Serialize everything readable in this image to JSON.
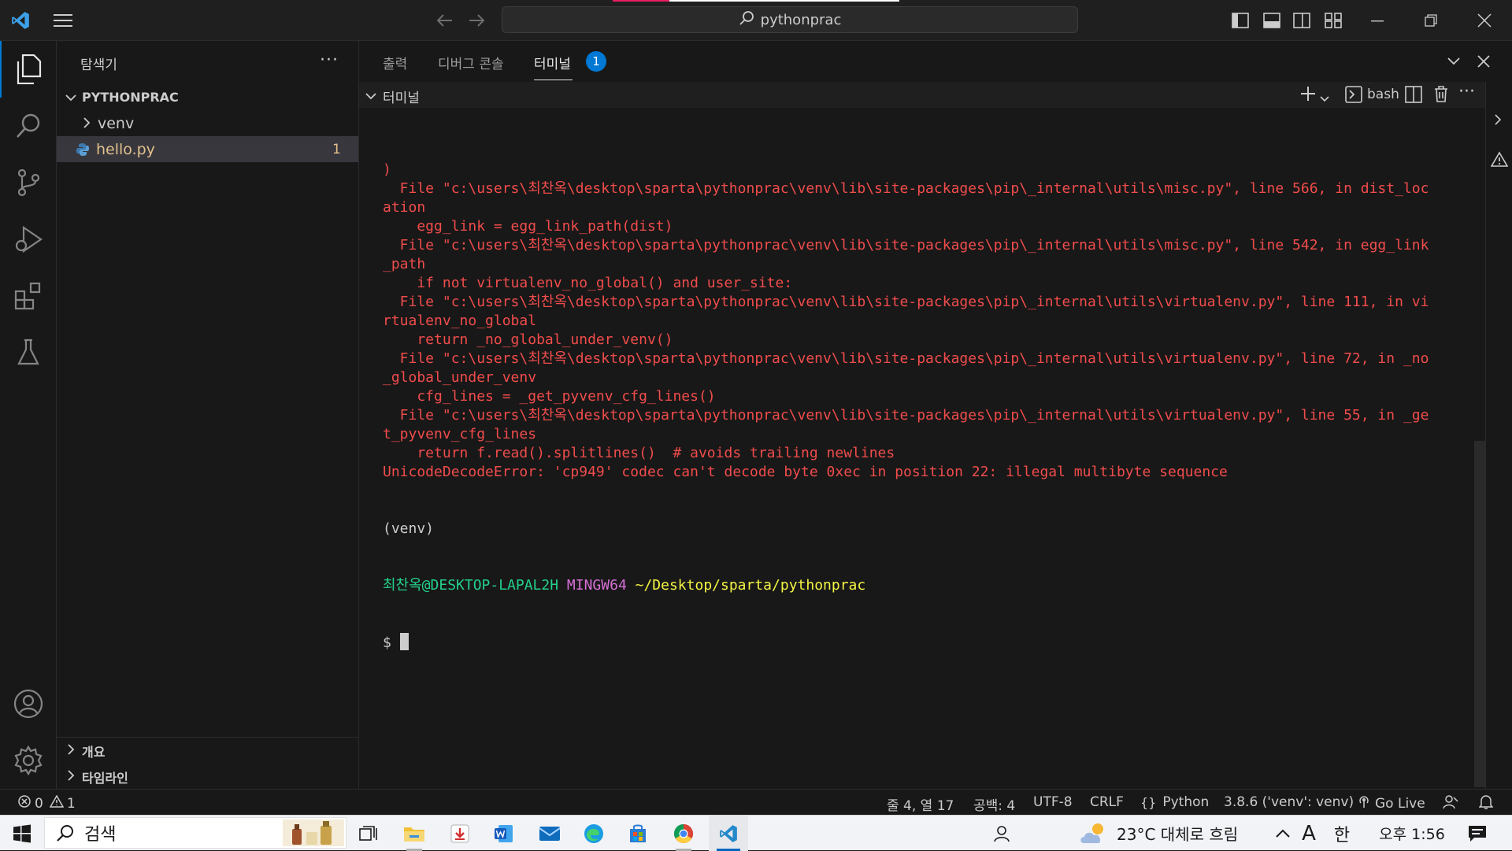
{
  "titlebar": {
    "search_text": "pythonprac"
  },
  "sidebar": {
    "title": "탐색기",
    "more": "···",
    "project": "PYTHONPRAC",
    "items": [
      {
        "label": "venv",
        "type": "folder"
      },
      {
        "label": "hello.py",
        "type": "file",
        "problems": "1"
      }
    ],
    "outline": "개요",
    "timeline": "타임라인"
  },
  "panel": {
    "tabs": [
      {
        "label": "출력"
      },
      {
        "label": "디버그 콘솔"
      },
      {
        "label": "터미널",
        "badge": "1"
      }
    ],
    "terminal_section": "터미널",
    "shell": "bash"
  },
  "terminal": {
    "lines": [
      ")",
      "  File \"c:\\users\\최찬옥\\desktop\\sparta\\pythonprac\\venv\\lib\\site-packages\\pip\\_internal\\utils\\misc.py\", line 566, in dist_loc",
      "ation",
      "    egg_link = egg_link_path(dist)",
      "  File \"c:\\users\\최찬옥\\desktop\\sparta\\pythonprac\\venv\\lib\\site-packages\\pip\\_internal\\utils\\misc.py\", line 542, in egg_link",
      "_path",
      "    if not virtualenv_no_global() and user_site:",
      "  File \"c:\\users\\최찬옥\\desktop\\sparta\\pythonprac\\venv\\lib\\site-packages\\pip\\_internal\\utils\\virtualenv.py\", line 111, in vi",
      "rtualenv_no_global",
      "    return _no_global_under_venv()",
      "  File \"c:\\users\\최찬옥\\desktop\\sparta\\pythonprac\\venv\\lib\\site-packages\\pip\\_internal\\utils\\virtualenv.py\", line 72, in _no",
      "_global_under_venv",
      "    cfg_lines = _get_pyvenv_cfg_lines()",
      "  File \"c:\\users\\최찬옥\\desktop\\sparta\\pythonprac\\venv\\lib\\site-packages\\pip\\_internal\\utils\\virtualenv.py\", line 55, in _ge",
      "t_pyvenv_cfg_lines",
      "    return f.read().splitlines()  # avoids trailing newlines",
      "UnicodeDecodeError: 'cp949' codec can't decode byte 0xec in position 22: illegal multibyte sequence"
    ],
    "venv_line": "(venv)",
    "prompt_user": "최찬옥@DESKTOP-LAPAL2H",
    "prompt_sys": "MINGW64",
    "prompt_path": "~/Desktop/sparta/pythonprac",
    "prompt_symbol": "$"
  },
  "statusbar": {
    "errors": "0",
    "warnings": "1",
    "position": "줄 4, 열 17",
    "spaces": "공백: 4",
    "encoding": "UTF-8",
    "eol": "CRLF",
    "language": "Python",
    "interpreter": "3.8.6 ('venv': venv)",
    "golive": "Go Live"
  },
  "taskbar": {
    "search": "검색",
    "weather": "23°C 대체로 흐림",
    "ime_a": "A",
    "ime_lang": "한",
    "time": "오후 1:56"
  },
  "colors": {
    "accent": "#0078d4",
    "error_text": "#f14c4c",
    "prompt_user": "#23d18b",
    "prompt_sys": "#d670d6",
    "prompt_path": "#f5f543",
    "modified_file": "#e2c08d"
  }
}
